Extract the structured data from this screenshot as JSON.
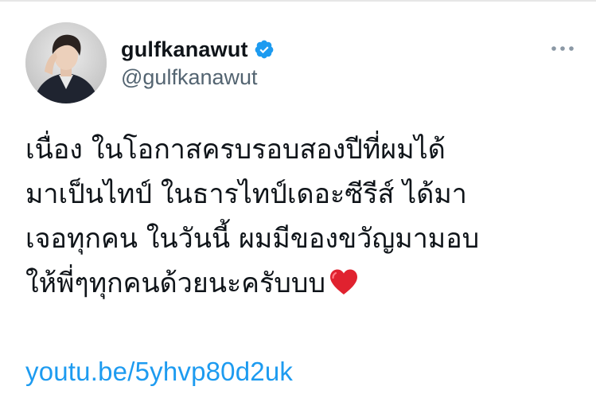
{
  "tweet": {
    "author": {
      "display_name": "gulfkanawut",
      "handle": "@gulfkanawut",
      "verified": true,
      "avatar_icon": "profile-photo"
    },
    "more_icon": "ellipsis-horizontal-icon",
    "text_lines": [
      "เนื่อง ในโอกาสครบรอบสองปีที่ผมได้",
      "มาเป็นไทป์  ในธารไทป์เดอะซีรีส์ ได้มา",
      "เจอทุกคน ในวันนี้ ผมมีของขวัญมามอบ",
      "ให้พี่ๆทุกคนด้วยนะครับบบ"
    ],
    "emoji": "red-heart-icon",
    "link": "youtu.be/5yhvp80d2uk"
  },
  "colors": {
    "link": "#1d9bf0",
    "verified_badge": "#1d9bf0",
    "secondary_text": "#536471",
    "heart": "#e0222f"
  }
}
